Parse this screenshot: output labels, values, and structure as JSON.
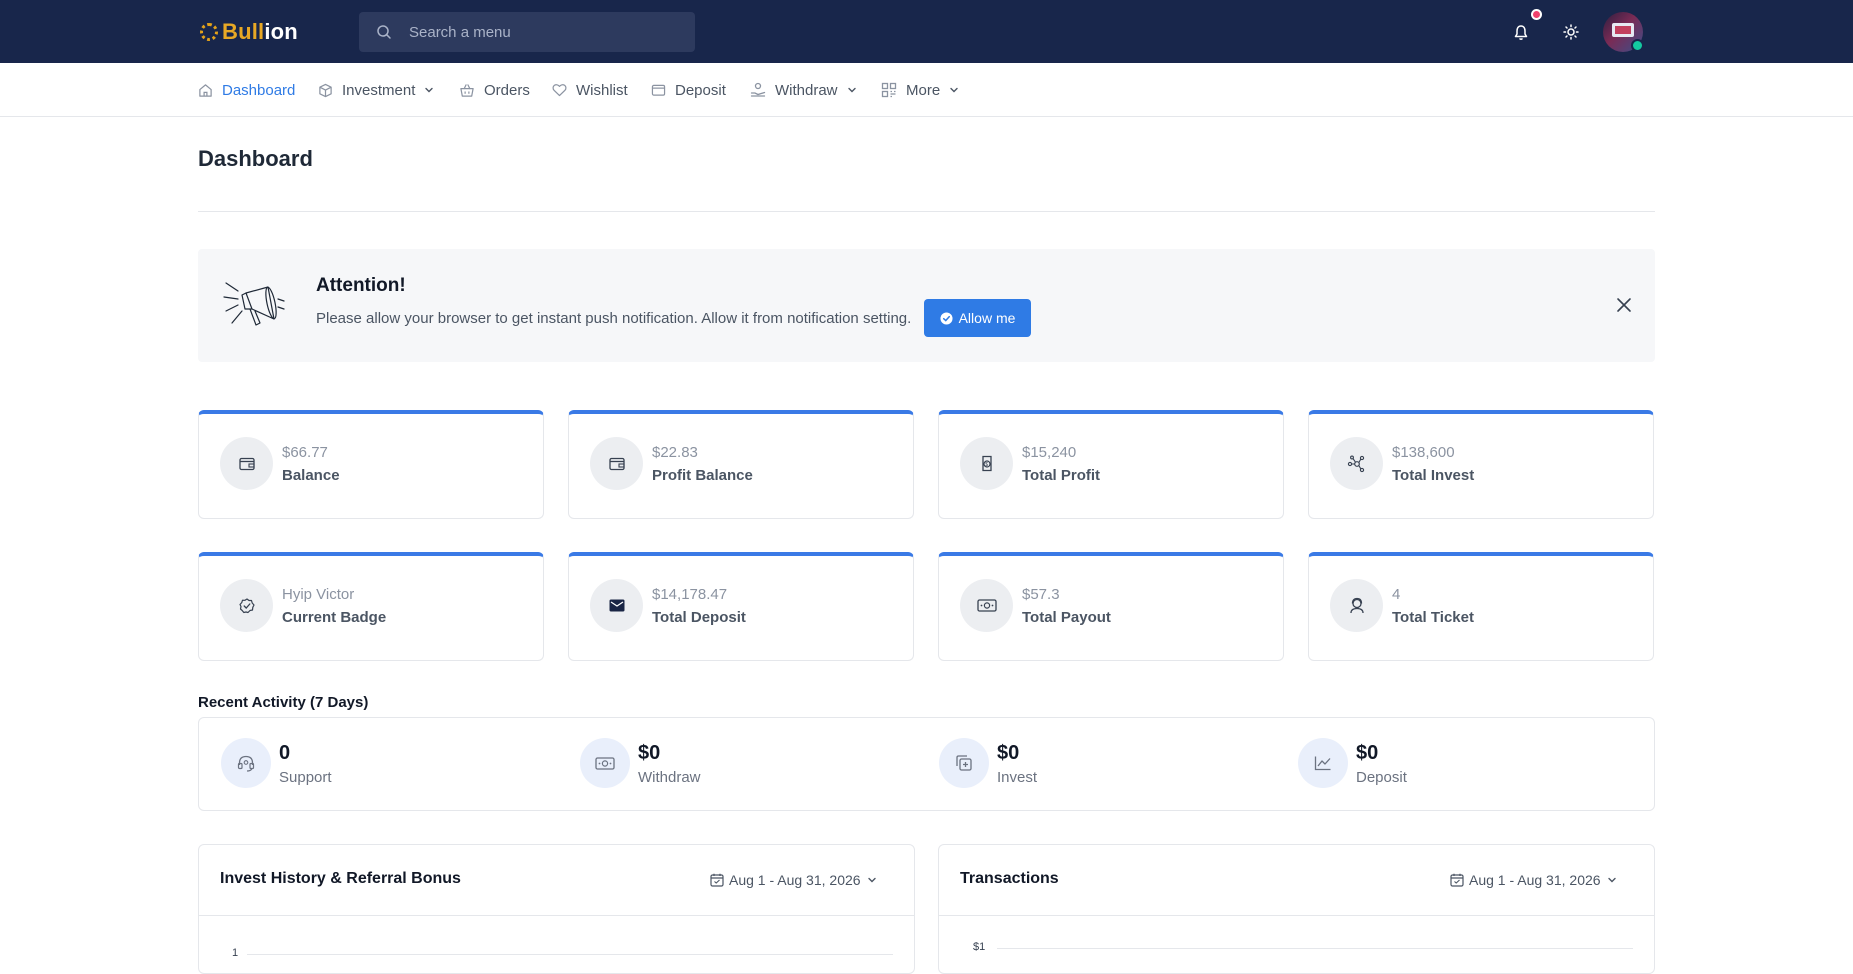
{
  "brand": {
    "logo_part1": "Bull",
    "logo_part2": "ion",
    "accent": "#e8a825"
  },
  "search": {
    "placeholder": "Search a menu",
    "icon": "search-icon"
  },
  "topbar": {
    "background": "#18264b",
    "notification_icon": "bell-icon",
    "theme_icon": "sun-icon",
    "status": "online"
  },
  "nav": {
    "items": [
      {
        "label": "Dashboard",
        "icon": "home-icon",
        "active": true
      },
      {
        "label": "Investment",
        "icon": "box-icon",
        "dropdown": true
      },
      {
        "label": "Orders",
        "icon": "basket-icon"
      },
      {
        "label": "Wishlist",
        "icon": "heart-icon"
      },
      {
        "label": "Deposit",
        "icon": "wallet-icon"
      },
      {
        "label": "Withdraw",
        "icon": "hand-coin-icon",
        "dropdown": true
      },
      {
        "label": "More",
        "icon": "grid-icon",
        "dropdown": true
      }
    ],
    "active_color": "#2f7be5"
  },
  "page": {
    "title": "Dashboard"
  },
  "alert": {
    "title": "Attention!",
    "text": "Please allow your browser to get instant push notification. Allow it from notification setting.",
    "button_label": "Allow me",
    "icon": "megaphone-icon"
  },
  "stats": [
    {
      "value": "$66.77",
      "label": "Balance",
      "icon": "wallet-icon"
    },
    {
      "value": "$22.83",
      "label": "Profit Balance",
      "icon": "wallet-icon"
    },
    {
      "value": "$15,240",
      "label": "Total Profit",
      "icon": "money-bag-icon"
    },
    {
      "value": "$138,600",
      "label": "Total Invest",
      "icon": "network-icon"
    },
    {
      "value": "Hyip Victor",
      "label": "Current Badge",
      "icon": "badge-check-icon"
    },
    {
      "value": "$14,178.47",
      "label": "Total Deposit",
      "icon": "wallet-filled-icon"
    },
    {
      "value": "$57.3",
      "label": "Total Payout",
      "icon": "cash-icon"
    },
    {
      "value": "4",
      "label": "Total Ticket",
      "icon": "support-agent-icon"
    }
  ],
  "recent_activity": {
    "title": "Recent Activity (7 Days)",
    "items": [
      {
        "value": "0",
        "label": "Support",
        "icon": "headset-icon"
      },
      {
        "value": "$0",
        "label": "Withdraw",
        "icon": "cash-icon"
      },
      {
        "value": "$0",
        "label": "Invest",
        "icon": "invest-add-icon"
      },
      {
        "value": "$0",
        "label": "Deposit",
        "icon": "line-chart-icon"
      }
    ]
  },
  "panels": {
    "invest_history": {
      "title": "Invest History & Referral Bonus",
      "range": "Aug 1 - Aug 31, 2026",
      "first_tick": "1"
    },
    "transactions": {
      "title": "Transactions",
      "range": "Aug 1 - Aug 31, 2026",
      "first_tick": "$1"
    }
  }
}
